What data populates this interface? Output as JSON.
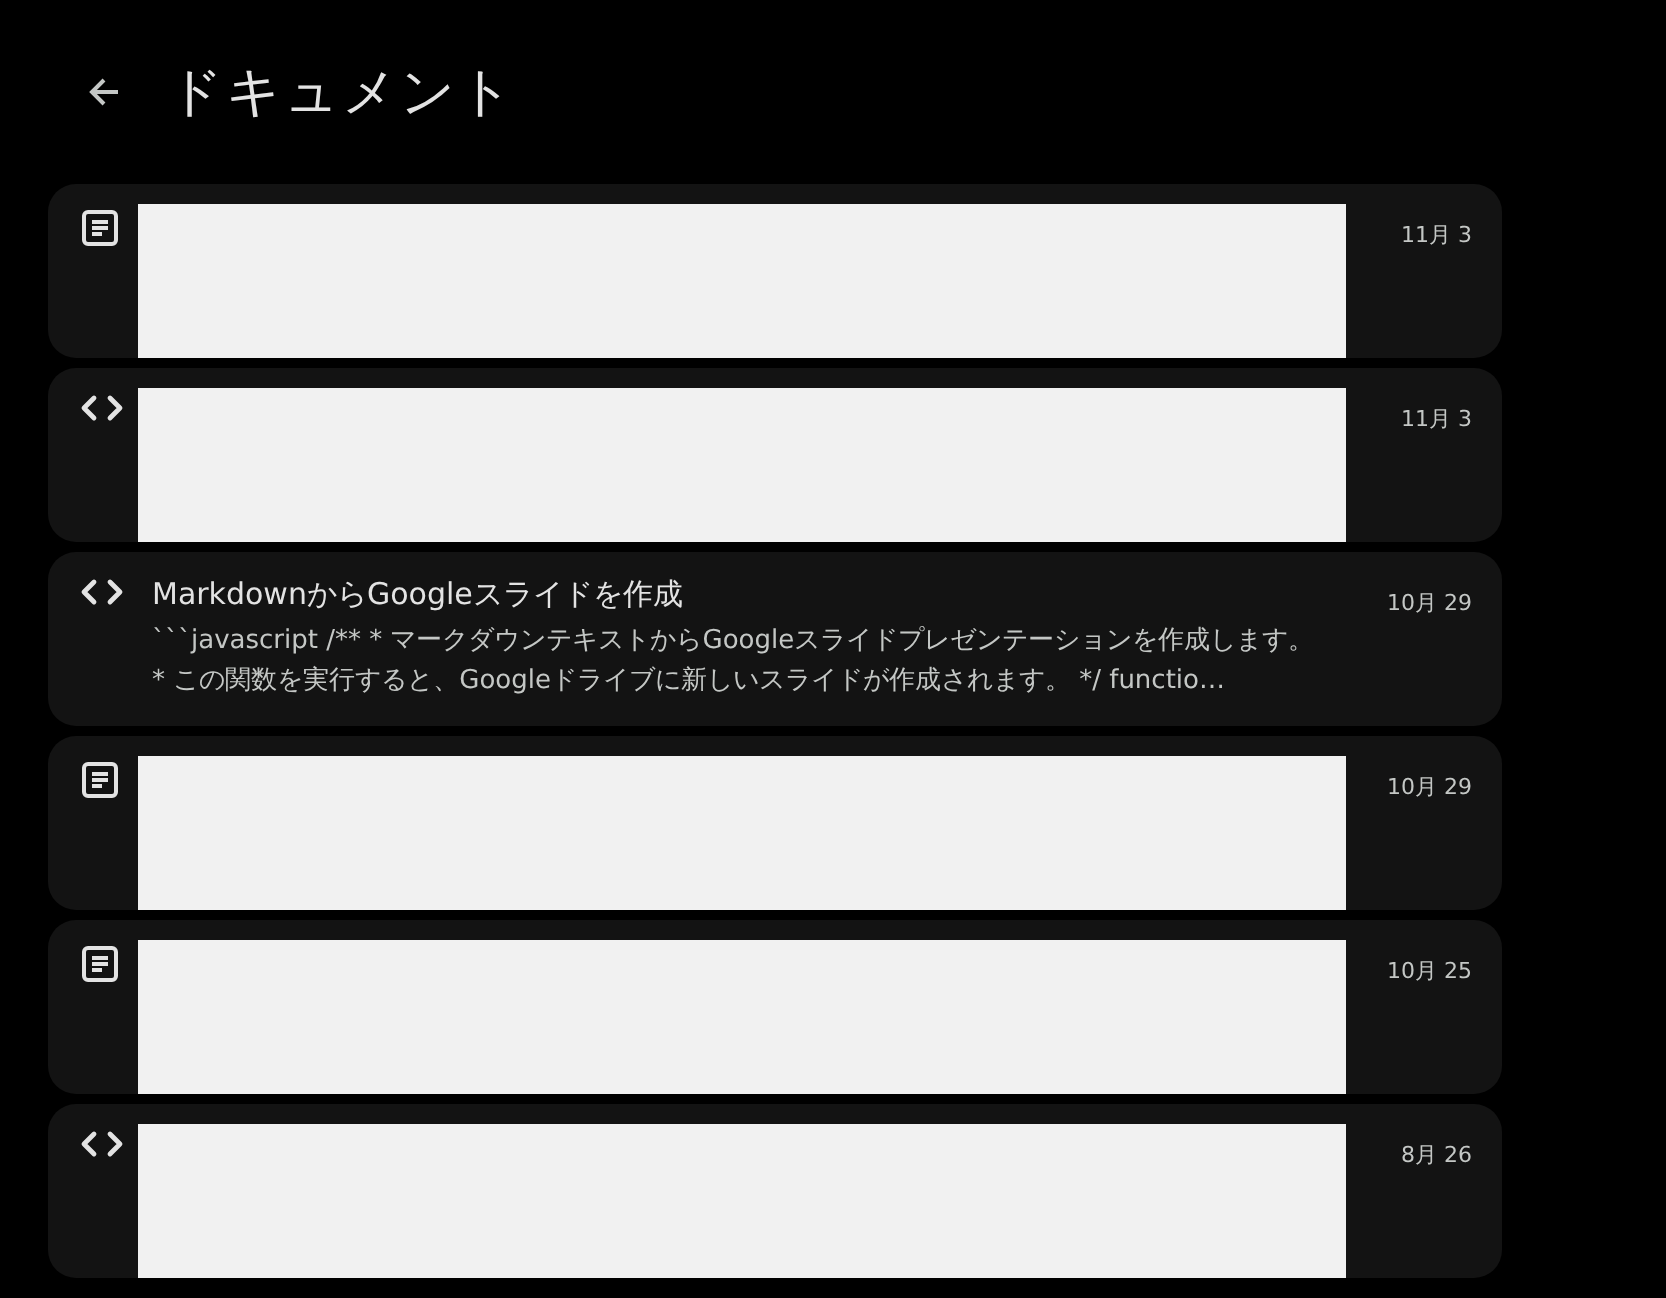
{
  "header": {
    "title": "ドキュメント"
  },
  "documents": [
    {
      "kind": "doc",
      "redacted": true,
      "date": "11月 3"
    },
    {
      "kind": "code",
      "redacted": true,
      "date": "11月 3"
    },
    {
      "kind": "code",
      "redacted": false,
      "title": "MarkdownからGoogleスライドを作成",
      "snippet": "```javascript /** * マークダウンテキストからGoogleスライドプレゼンテーションを作成します。 * この関数を実行すると、Googleドライブに新しいスライドが作成されます。 */ functio…",
      "date": "10月 29"
    },
    {
      "kind": "doc",
      "redacted": true,
      "date": "10月 29"
    },
    {
      "kind": "doc",
      "redacted": true,
      "date": "10月 25"
    },
    {
      "kind": "code",
      "redacted": true,
      "date": "8月 26"
    }
  ]
}
